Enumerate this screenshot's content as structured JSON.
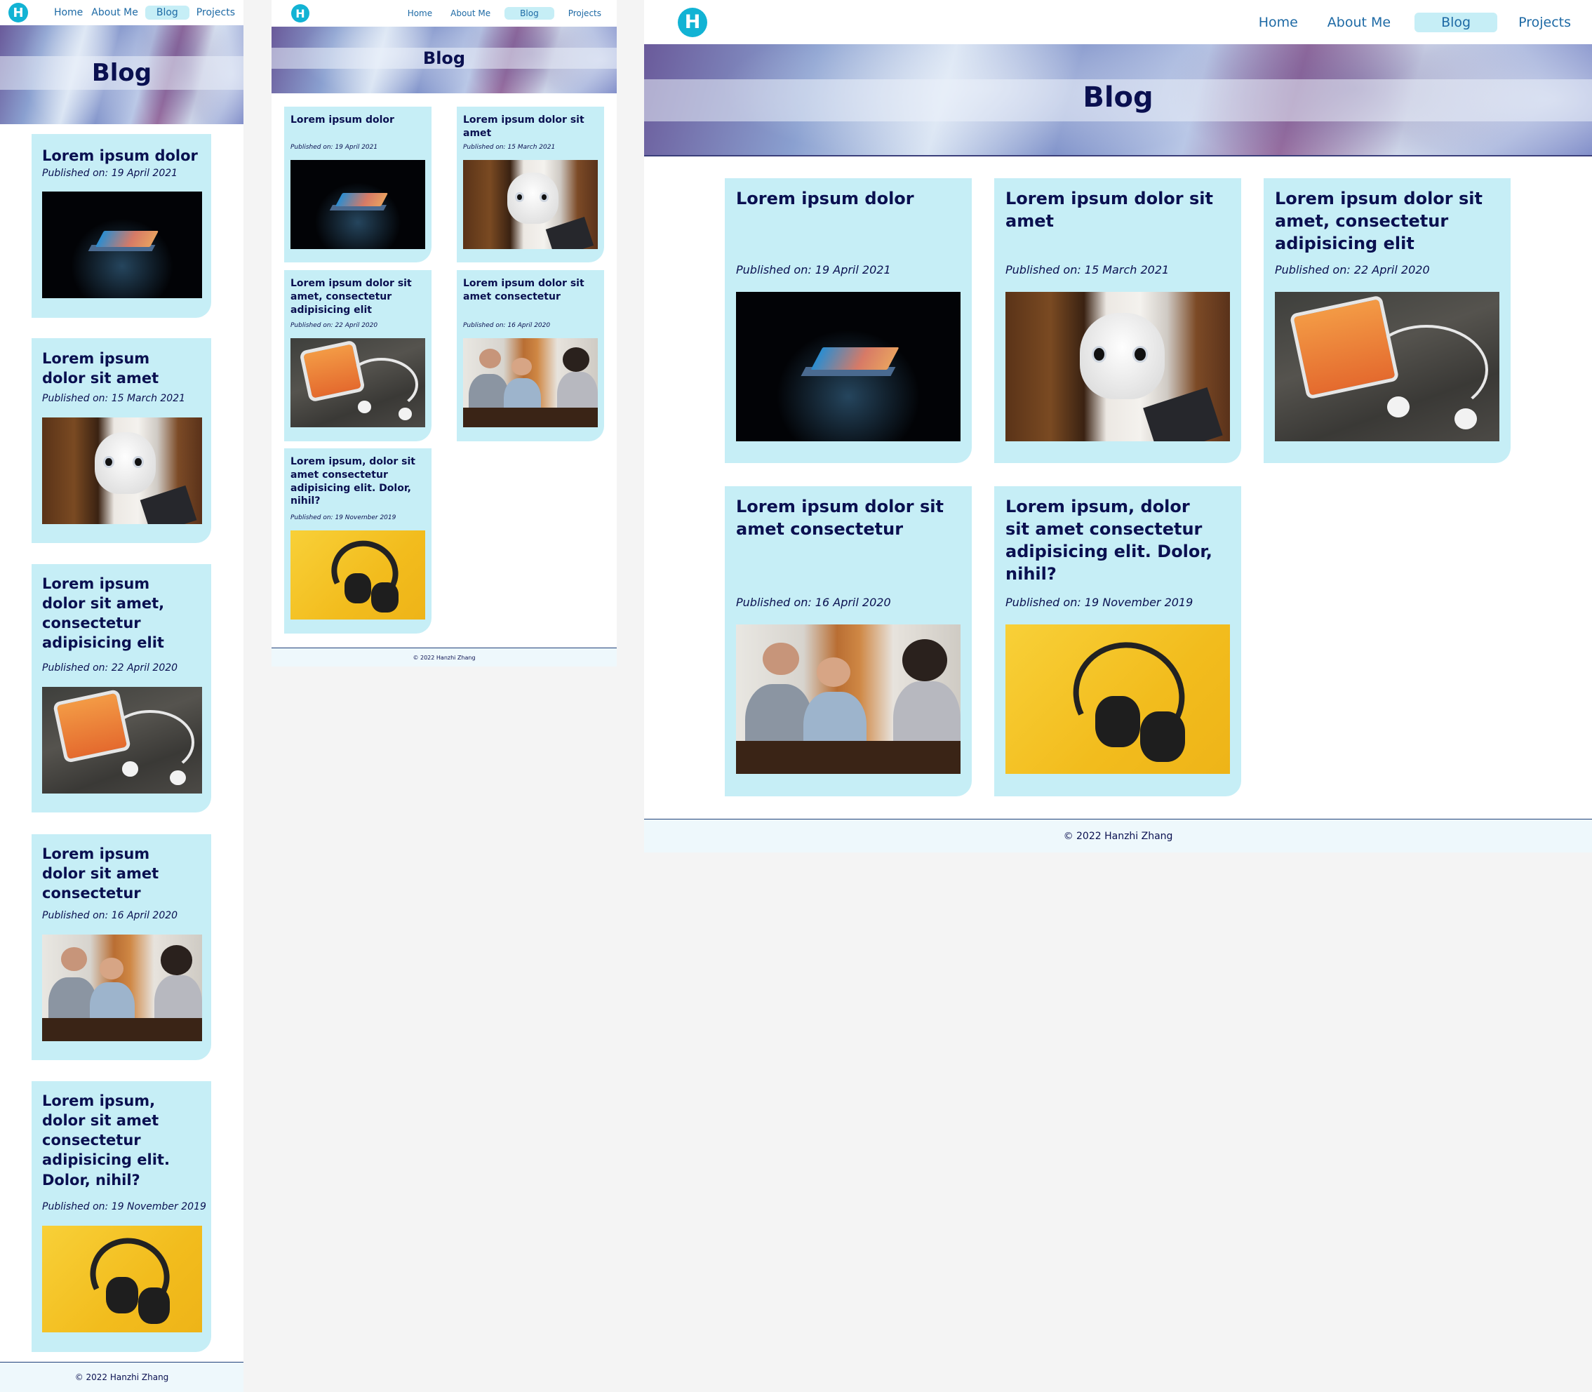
{
  "site": {
    "logo_letter": "H",
    "nav": [
      "Home",
      "About Me",
      "Blog",
      "Projects"
    ],
    "active_nav": "Blog",
    "page_title": "Blog",
    "footer": "© 2022 Hanzhi Zhang"
  },
  "posts": [
    {
      "title": "Lorem ipsum dolor",
      "date": "Published on: 19 April 2021",
      "image": "laptop-dark"
    },
    {
      "title": "Lorem ipsum dolor sit amet",
      "date": "Published on: 15 March 2021",
      "image": "robot"
    },
    {
      "title": "Lorem ipsum dolor sit amet, consectetur adipisicing elit",
      "date": "Published on: 22 April 2020",
      "image": "phone-earphones"
    },
    {
      "title": "Lorem ipsum dolor sit amet consectetur",
      "date": "Published on: 16 April 2020",
      "image": "people-table"
    },
    {
      "title": "Lorem ipsum, dolor sit amet consectetur adipisicing elit. Dolor, nihil?",
      "date": "Published on: 19 November 2019",
      "image": "headphones-yellow"
    }
  ],
  "colors": {
    "card": "#c6eef6",
    "heading": "#0a1050",
    "nav_link": "#1e6aa5",
    "logo": "#12b3d4",
    "footer_bg": "#eef8fc"
  }
}
